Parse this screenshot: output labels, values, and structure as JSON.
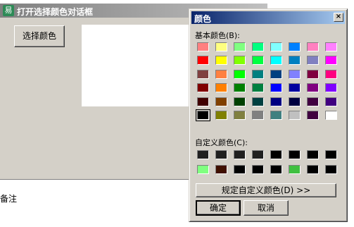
{
  "main_window": {
    "title": "打开选择颜色对话框",
    "icon_glyph": "易",
    "select_color_button": "选择颜色"
  },
  "remark_text": "备注",
  "dialog": {
    "title": "颜色",
    "close_glyph": "×",
    "basic_colors_label": "基本颜色(B):",
    "custom_colors_label": "自定义颜色(C):",
    "define_custom_button": "规定自定义颜色(D) >>",
    "ok_button": "确定",
    "cancel_button": "取消"
  },
  "basic_colors": [
    [
      "#ff8080",
      "#ffff80",
      "#80ff80",
      "#00ff80",
      "#80ffff",
      "#0080ff",
      "#ff80c0",
      "#ff80ff"
    ],
    [
      "#ff0000",
      "#ffff00",
      "#80ff00",
      "#00ff40",
      "#00ffff",
      "#0080c0",
      "#8080c0",
      "#ff00ff"
    ],
    [
      "#804040",
      "#ff8040",
      "#00ff00",
      "#008080",
      "#004080",
      "#8080ff",
      "#800040",
      "#ff0080"
    ],
    [
      "#800000",
      "#ff8000",
      "#008000",
      "#008040",
      "#0000ff",
      "#0000a0",
      "#800080",
      "#8000ff"
    ],
    [
      "#400000",
      "#804000",
      "#004000",
      "#004040",
      "#000080",
      "#000040",
      "#400040",
      "#400080"
    ],
    [
      "#000000",
      "#808000",
      "#808040",
      "#808080",
      "#408080",
      "#c0c0c0",
      "#400040",
      "#ffffff"
    ]
  ],
  "selected_basic": "#000000",
  "custom_colors": [
    [
      "#202020",
      "#202020",
      "#202020",
      "#202020",
      "#000000",
      "#000000",
      "#000000",
      "#000000"
    ],
    [
      "#80ff80",
      "#401000",
      "#000000",
      "#000000",
      "#000000",
      "#40c040",
      "#000000",
      "#000000"
    ]
  ]
}
